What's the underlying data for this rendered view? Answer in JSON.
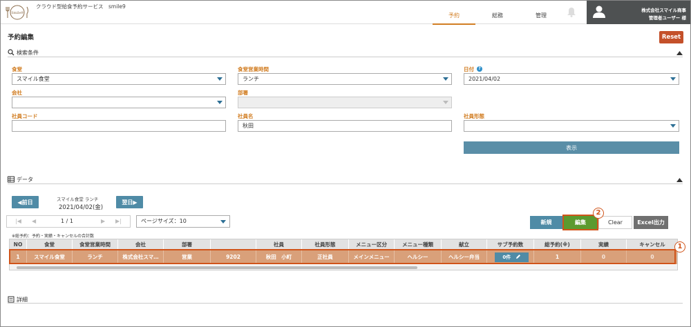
{
  "header": {
    "logo_text": "Smile9",
    "service_title": "クラウド型給食予約サービス　smile9",
    "nav": [
      {
        "label": "予約",
        "active": true
      },
      {
        "label": "総務",
        "active": false
      },
      {
        "label": "管理",
        "active": false
      }
    ],
    "user_company": "株式会社スマイル商事",
    "user_name": "管理者ユーザー 様"
  },
  "page": {
    "title": "予約編集",
    "reset_label": "Reset"
  },
  "search": {
    "section_title": "検索条件",
    "cafeteria_label": "食堂",
    "cafeteria_value": "スマイル食堂",
    "meal_time_label": "食堂営業時間",
    "meal_time_value": "ランチ",
    "date_label": "日付",
    "date_value": "2021/04/02",
    "help_glyph": "?",
    "company_label": "会社",
    "company_value": "",
    "department_label": "部署",
    "department_value": "",
    "employee_code_label": "社員コード",
    "employee_code_value": "",
    "employee_name_label": "社員名",
    "employee_name_value": "秋田",
    "employee_type_label": "社員形態",
    "employee_type_value": "",
    "show_label": "表示"
  },
  "data_section": {
    "title": "データ",
    "prev_label": "◀前日",
    "next_label": "翌日▶",
    "selection_info": "スマイル食堂 ランチ",
    "selection_date": "2021/04/02(金)",
    "pager_info": "1 / 1",
    "page_size": "ページサイズ：10",
    "new_label": "新規",
    "edit_label": "編集",
    "clear_label": "Clear",
    "excel_label": "Excel出力",
    "note": "※総予約：予約・実績・キャンセルの合計数"
  },
  "table": {
    "headers": [
      "NO",
      "食堂",
      "食堂営業時間",
      "会社",
      "部署",
      "",
      "社員",
      "社員形態",
      "メニュー区分",
      "メニュー種類",
      "献立",
      "サブ予約数",
      "総予約(※)",
      "実績",
      "キャンセル"
    ],
    "row": {
      "no": "1",
      "cafeteria": "スマイル食堂",
      "meal_time": "ランチ",
      "company": "株式会社スマ…",
      "department": "営業",
      "code": "9202",
      "employee": "秋田　小町",
      "employee_type": "正社員",
      "menu_category": "メインメニュー",
      "menu_type": "ヘルシー",
      "dish": "ヘルシー弁当",
      "sub_reservations": "0件",
      "total_reservations": "1",
      "actual": "0",
      "cancel": "0"
    }
  },
  "annotations": {
    "badge1": "1",
    "badge2": "2"
  },
  "detail": {
    "title": "詳細"
  },
  "colors": {
    "accent": "#d17d22",
    "button_blue": "#4f8ba6",
    "edit_green": "#5b9a2f",
    "reset_red": "#c4502a",
    "selected_row": "#d9a07a",
    "highlight": "#d0541a"
  }
}
